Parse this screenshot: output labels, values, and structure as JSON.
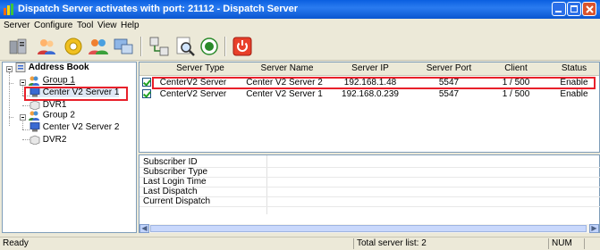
{
  "window": {
    "title": "Dispatch Server activates with port: 21112 - Dispatch Server"
  },
  "menu": [
    "Server",
    "Configure",
    "Tool",
    "View",
    "Help"
  ],
  "toolbar": {
    "icons": [
      "servers-icon",
      "users-icon",
      "settings-icon",
      "group-icon",
      "network-icon",
      "connect-icon",
      "search-icon",
      "refresh-icon",
      "power-icon"
    ]
  },
  "tree": {
    "root": "Address Book",
    "groups": [
      {
        "label": "Group 1",
        "children": [
          "Center V2 Server 1",
          "DVR1"
        ]
      },
      {
        "label": "Group 2",
        "children": [
          "Center V2 Server 2",
          "DVR2"
        ]
      }
    ]
  },
  "grid": {
    "columns": [
      "Server Type",
      "Server Name",
      "Server IP",
      "Server Port",
      "Client",
      "Status"
    ],
    "rows": [
      {
        "type": "CenterV2 Server",
        "name": "Center V2 Server 2",
        "ip": "192.168.1.48",
        "port": "5547",
        "client": "1 / 500",
        "status": "Enable",
        "checked": true
      },
      {
        "type": "CenterV2 Server",
        "name": "Center V2 Server 1",
        "ip": "192.168.0.239",
        "port": "5547",
        "client": "1 / 500",
        "status": "Enable",
        "checked": true
      }
    ]
  },
  "details": [
    "Subscriber ID",
    "Subscriber Type",
    "Last Login Time",
    "Last Dispatch",
    "Current Dispatch"
  ],
  "statusbar": {
    "left": "Ready",
    "middle": "Total server list: 2",
    "right": "NUM"
  },
  "colors": {
    "titlebar": "#0a5fe0",
    "highlight": "#e8202a",
    "selection": "#316ac5"
  }
}
